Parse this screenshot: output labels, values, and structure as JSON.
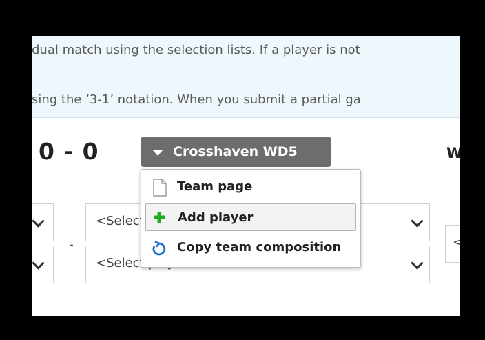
{
  "info": {
    "line1": "dual match using the selection lists. If a player is not",
    "line2": "sing the ’3-1’ notation. When you submit a partial ga"
  },
  "score": "0 - 0",
  "team_button": {
    "label": "Crosshaven WD5"
  },
  "right_label": "W",
  "selects": {
    "player_placeholder_1": "<Select player>",
    "player_placeholder_2": "<Select player>",
    "right_partial": "<"
  },
  "menu": {
    "items": [
      {
        "label": "Team page",
        "icon": "page-icon"
      },
      {
        "label": "Add player",
        "icon": "plus-icon",
        "color": "#22aa22"
      },
      {
        "label": "Copy team composition",
        "icon": "refresh-icon",
        "color": "#1a73c9"
      }
    ]
  }
}
